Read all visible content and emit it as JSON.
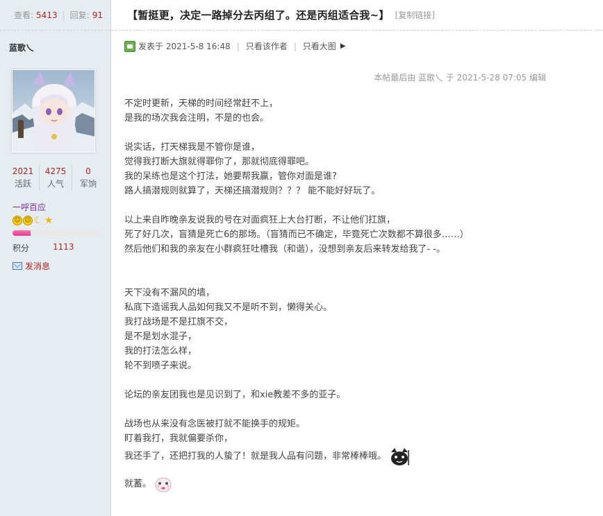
{
  "sidebar": {
    "views_label": "查看:",
    "views_value": "5413",
    "replies_label": "回复:",
    "replies_value": "91",
    "username": "蓝歌乀",
    "stats": [
      {
        "value": "2021",
        "label": "活跃"
      },
      {
        "value": "4275",
        "label": "人气"
      },
      {
        "value": "0",
        "label": "军饷"
      }
    ],
    "group_title": "一呼百应",
    "progress_fraction": 0.2,
    "score_label": "积分",
    "score_value": "1113",
    "pm_label": "发消息"
  },
  "post": {
    "title": "【暂挺更，决定一路掉分去丙组了。还是丙组适合我~】",
    "copy_link": "[复制链接]",
    "posted_on": "发表于 2021-5-8 16:48",
    "only_author": "只看该作者",
    "only_big_image": "只看大图",
    "last_edit": "本帖最后由 蓝歌乀 于 2021-5-28 07:05 编辑",
    "lines": [
      "不定时更新，天梯的时间经常赶不上，",
      "是我的场次我会注明，不是的也会。",
      "",
      "说实话，打天梯我是不管你是谁，",
      "觉得我打断大旗就得罪你了，那就彻底得罪吧。",
      "我的呆练也是这个打法，她要帮我赢，管你对面是谁?",
      "路人搞潜规则就算了，天梯还搞潜规则？？？ 能不能好好玩了。",
      "",
      "以上来自昨晚亲友说我的号在对面疯狂上大台打断，不让他们扛旗，",
      "死了好几次，盲猜是死亡6的那场。（盲猜而已不确定，毕竟死亡次数都不算很多……）",
      "然后他们和我的亲友在小群疯狂吐槽我（和谐），没想到亲友后来转发给我了- -。",
      "",
      "",
      "天下没有不漏风的墙，",
      "私底下造谣我人品如何我又不是听不到，懒得关心。",
      "我打战场是不是扛旗不交，",
      "是不是划水混子，",
      "我的打法怎么样，",
      "轮不到喷子来说。",
      "",
      "论坛的亲友团我也是见识到了，和xie教差不多的亚子。",
      "",
      "战场也从来没有念医被打就不能换手的规矩。",
      "盯着我打，我就偏要杀你，",
      "我还手了，还把打我的人蛰了！就是我人品有问题，非常棒棒哦。",
      "",
      "就蓄。"
    ]
  }
}
